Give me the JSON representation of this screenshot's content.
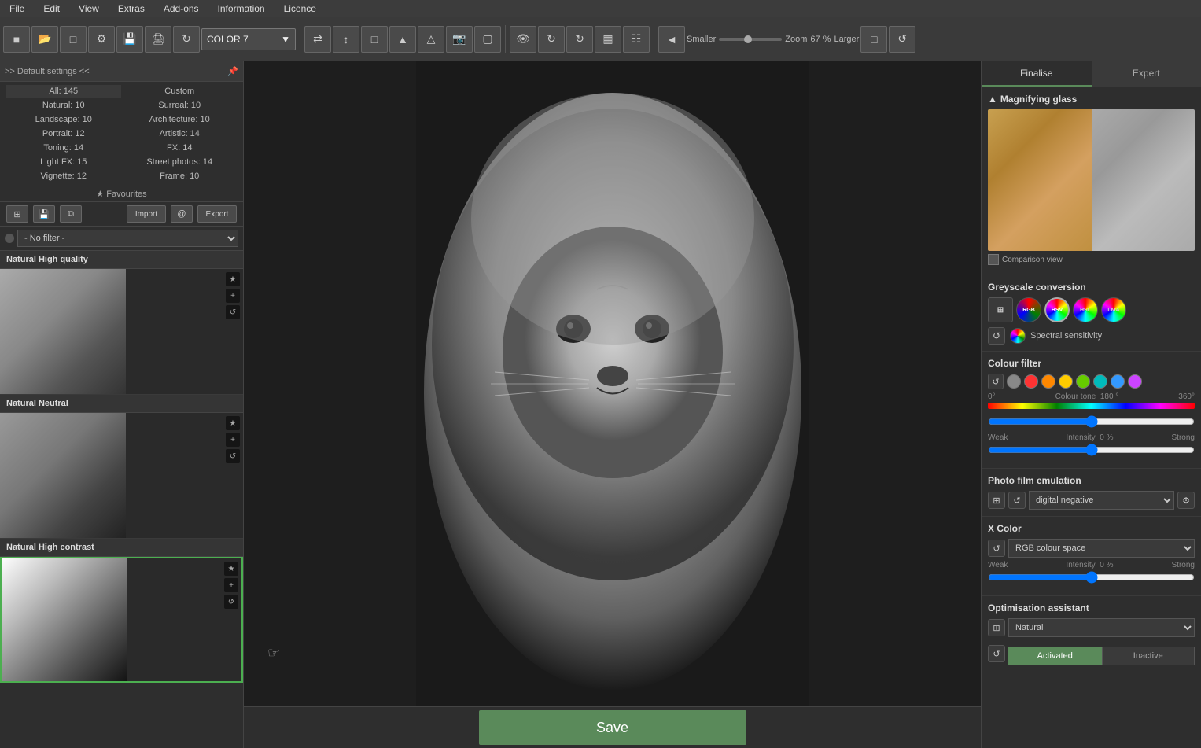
{
  "menubar": {
    "items": [
      "File",
      "Edit",
      "View",
      "Extras",
      "Add-ons",
      "Information",
      "Licence"
    ]
  },
  "toolbar": {
    "preset_label": "COLOR 7",
    "zoom_label": "Zoom",
    "zoom_value": "67",
    "zoom_unit": "%",
    "zoom_smaller": "Smaller",
    "zoom_larger": "Larger"
  },
  "left_panel": {
    "settings_label": ">> Default settings <<",
    "stats": [
      {
        "label": "All: 145",
        "key": "all"
      },
      {
        "label": "Custom",
        "key": "custom"
      },
      {
        "label": "Natural: 10",
        "key": "natural"
      },
      {
        "label": "Surreal: 10",
        "key": "surreal"
      },
      {
        "label": "Landscape: 10",
        "key": "landscape"
      },
      {
        "label": "Architecture: 10",
        "key": "architecture"
      },
      {
        "label": "Portrait: 12",
        "key": "portrait"
      },
      {
        "label": "Artistic: 14",
        "key": "artistic"
      },
      {
        "label": "Toning: 14",
        "key": "toning"
      },
      {
        "label": "FX: 14",
        "key": "fx"
      },
      {
        "label": "Light FX: 15",
        "key": "light_fx"
      },
      {
        "label": "Street photos: 14",
        "key": "street"
      },
      {
        "label": "Vignette: 12",
        "key": "vignette"
      },
      {
        "label": "Frame: 10",
        "key": "frame"
      }
    ],
    "favourites_label": "★ Favourites",
    "filter_placeholder": "- No filter -",
    "presets": [
      {
        "name": "Natural High quality",
        "key": "natural_high_quality"
      },
      {
        "name": "Natural Neutral",
        "key": "natural_neutral"
      },
      {
        "name": "Natural High contrast",
        "key": "natural_high_contrast"
      }
    ]
  },
  "canvas": {
    "save_label": "Save"
  },
  "right_panel": {
    "tabs": [
      {
        "label": "Finalise",
        "key": "finalise"
      },
      {
        "label": "Expert",
        "key": "expert"
      }
    ],
    "magnifying_glass": {
      "title": "Magnifying glass",
      "comparison_label": "Comparison view"
    },
    "greyscale": {
      "title": "Greyscale conversion",
      "icons": [
        "grid",
        "RGB",
        "HSV",
        "HSL",
        "LUMA"
      ],
      "spectral_label": "Spectral sensitivity"
    },
    "colour_filter": {
      "title": "Colour filter",
      "colours": [
        "#888",
        "#ff3333",
        "#ff8800",
        "#ffcc00",
        "#66cc00",
        "#00bbbb",
        "#3399ff",
        "#cc44ff"
      ],
      "colour_tone_label": "Colour tone",
      "colour_tone_value": "180",
      "colour_tone_unit": "°",
      "colour_tone_min": "0°",
      "colour_tone_max": "360°",
      "intensity_label": "Intensity",
      "intensity_value": "0",
      "intensity_unit": "%",
      "intensity_weak": "Weak",
      "intensity_strong": "Strong"
    },
    "photo_film": {
      "title": "Photo film emulation",
      "film_value": "digital negative"
    },
    "x_color": {
      "title": "X Color",
      "dropdown_value": "RGB colour space",
      "intensity_label": "Intensity",
      "intensity_value": "0",
      "intensity_unit": "%",
      "intensity_weak": "Weak",
      "intensity_strong": "Strong"
    },
    "optimisation": {
      "title": "Optimisation assistant",
      "dropdown_value": "Natural",
      "activated_label": "Activated",
      "inactive_label": "Inactive"
    }
  }
}
